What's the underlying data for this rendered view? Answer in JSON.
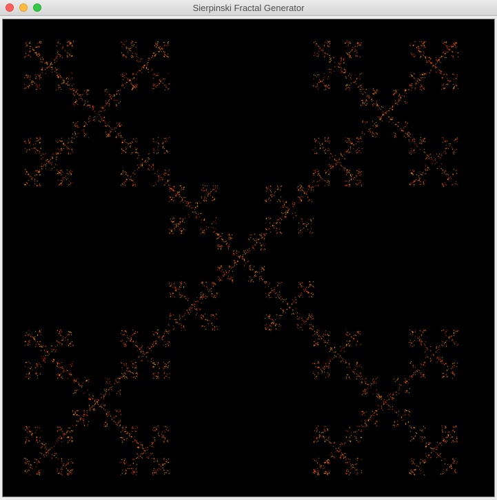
{
  "window": {
    "title": "Sierpinski Fractal Generator",
    "buttons": {
      "close": "close-icon",
      "minimize": "minimize-icon",
      "maximize": "zoom-icon"
    }
  },
  "fractal": {
    "background_color": "#000000",
    "palette": [
      "#ff3b00",
      "#ff5a00",
      "#ff7b10",
      "#ffa020",
      "#ffd040",
      "#c02000"
    ]
  }
}
